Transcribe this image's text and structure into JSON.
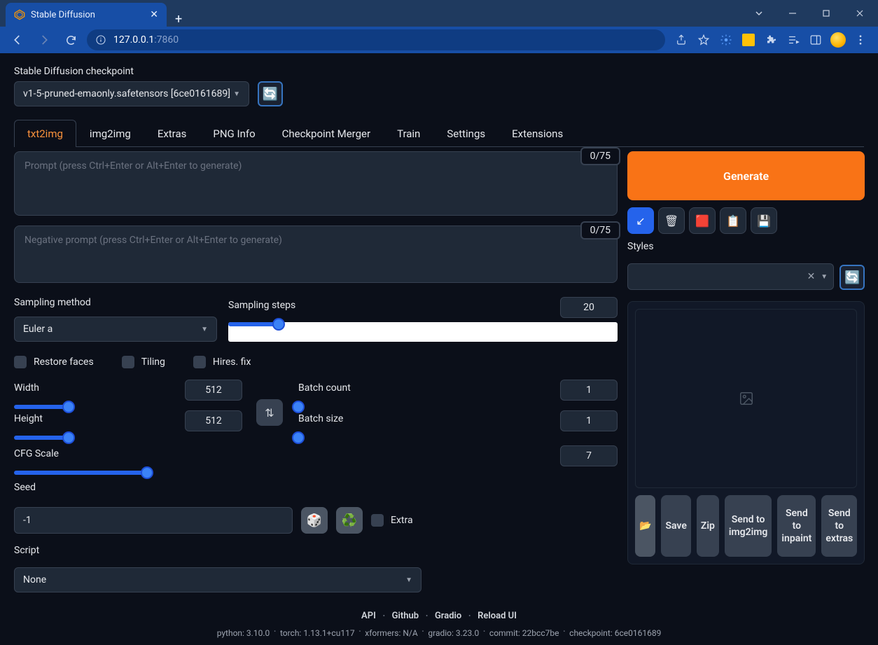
{
  "browser": {
    "tab_title": "Stable Diffusion",
    "url_prefix": "127.0.0.1",
    "url_suffix": ":7860"
  },
  "checkpoint": {
    "label": "Stable Diffusion checkpoint",
    "value": "v1-5-pruned-emaonly.safetensors [6ce0161689]"
  },
  "tabs": [
    "txt2img",
    "img2img",
    "Extras",
    "PNG Info",
    "Checkpoint Merger",
    "Train",
    "Settings",
    "Extensions"
  ],
  "prompt": {
    "placeholder": "Prompt (press Ctrl+Enter or Alt+Enter to generate)",
    "counter": "0/75"
  },
  "negative_prompt": {
    "placeholder": "Negative prompt (press Ctrl+Enter or Alt+Enter to generate)",
    "counter": "0/75"
  },
  "sampling": {
    "method_label": "Sampling method",
    "method_value": "Euler a",
    "steps_label": "Sampling steps",
    "steps_value": "20"
  },
  "checks": {
    "restore_faces": "Restore faces",
    "tiling": "Tiling",
    "hires_fix": "Hires. fix"
  },
  "dims": {
    "width_label": "Width",
    "width_value": "512",
    "height_label": "Height",
    "height_value": "512",
    "batch_count_label": "Batch count",
    "batch_count_value": "1",
    "batch_size_label": "Batch size",
    "batch_size_value": "1"
  },
  "cfg": {
    "label": "CFG Scale",
    "value": "7"
  },
  "seed": {
    "label": "Seed",
    "value": "-1",
    "extra_label": "Extra"
  },
  "script": {
    "label": "Script",
    "value": "None"
  },
  "generate_label": "Generate",
  "styles_label": "Styles",
  "output_buttons": {
    "folder": "📂",
    "save": "Save",
    "zip": "Zip",
    "send_img2img": "Send to img2img",
    "send_inpaint": "Send to inpaint",
    "send_extras": "Send to extras"
  },
  "footer": {
    "links": [
      "API",
      "Github",
      "Gradio",
      "Reload UI"
    ],
    "meta": [
      "python: 3.10.0",
      "torch: 1.13.1+cu117",
      "xformers: N/A",
      "gradio: 3.23.0",
      "commit: 22bcc7be",
      "checkpoint: 6ce0161689"
    ]
  }
}
